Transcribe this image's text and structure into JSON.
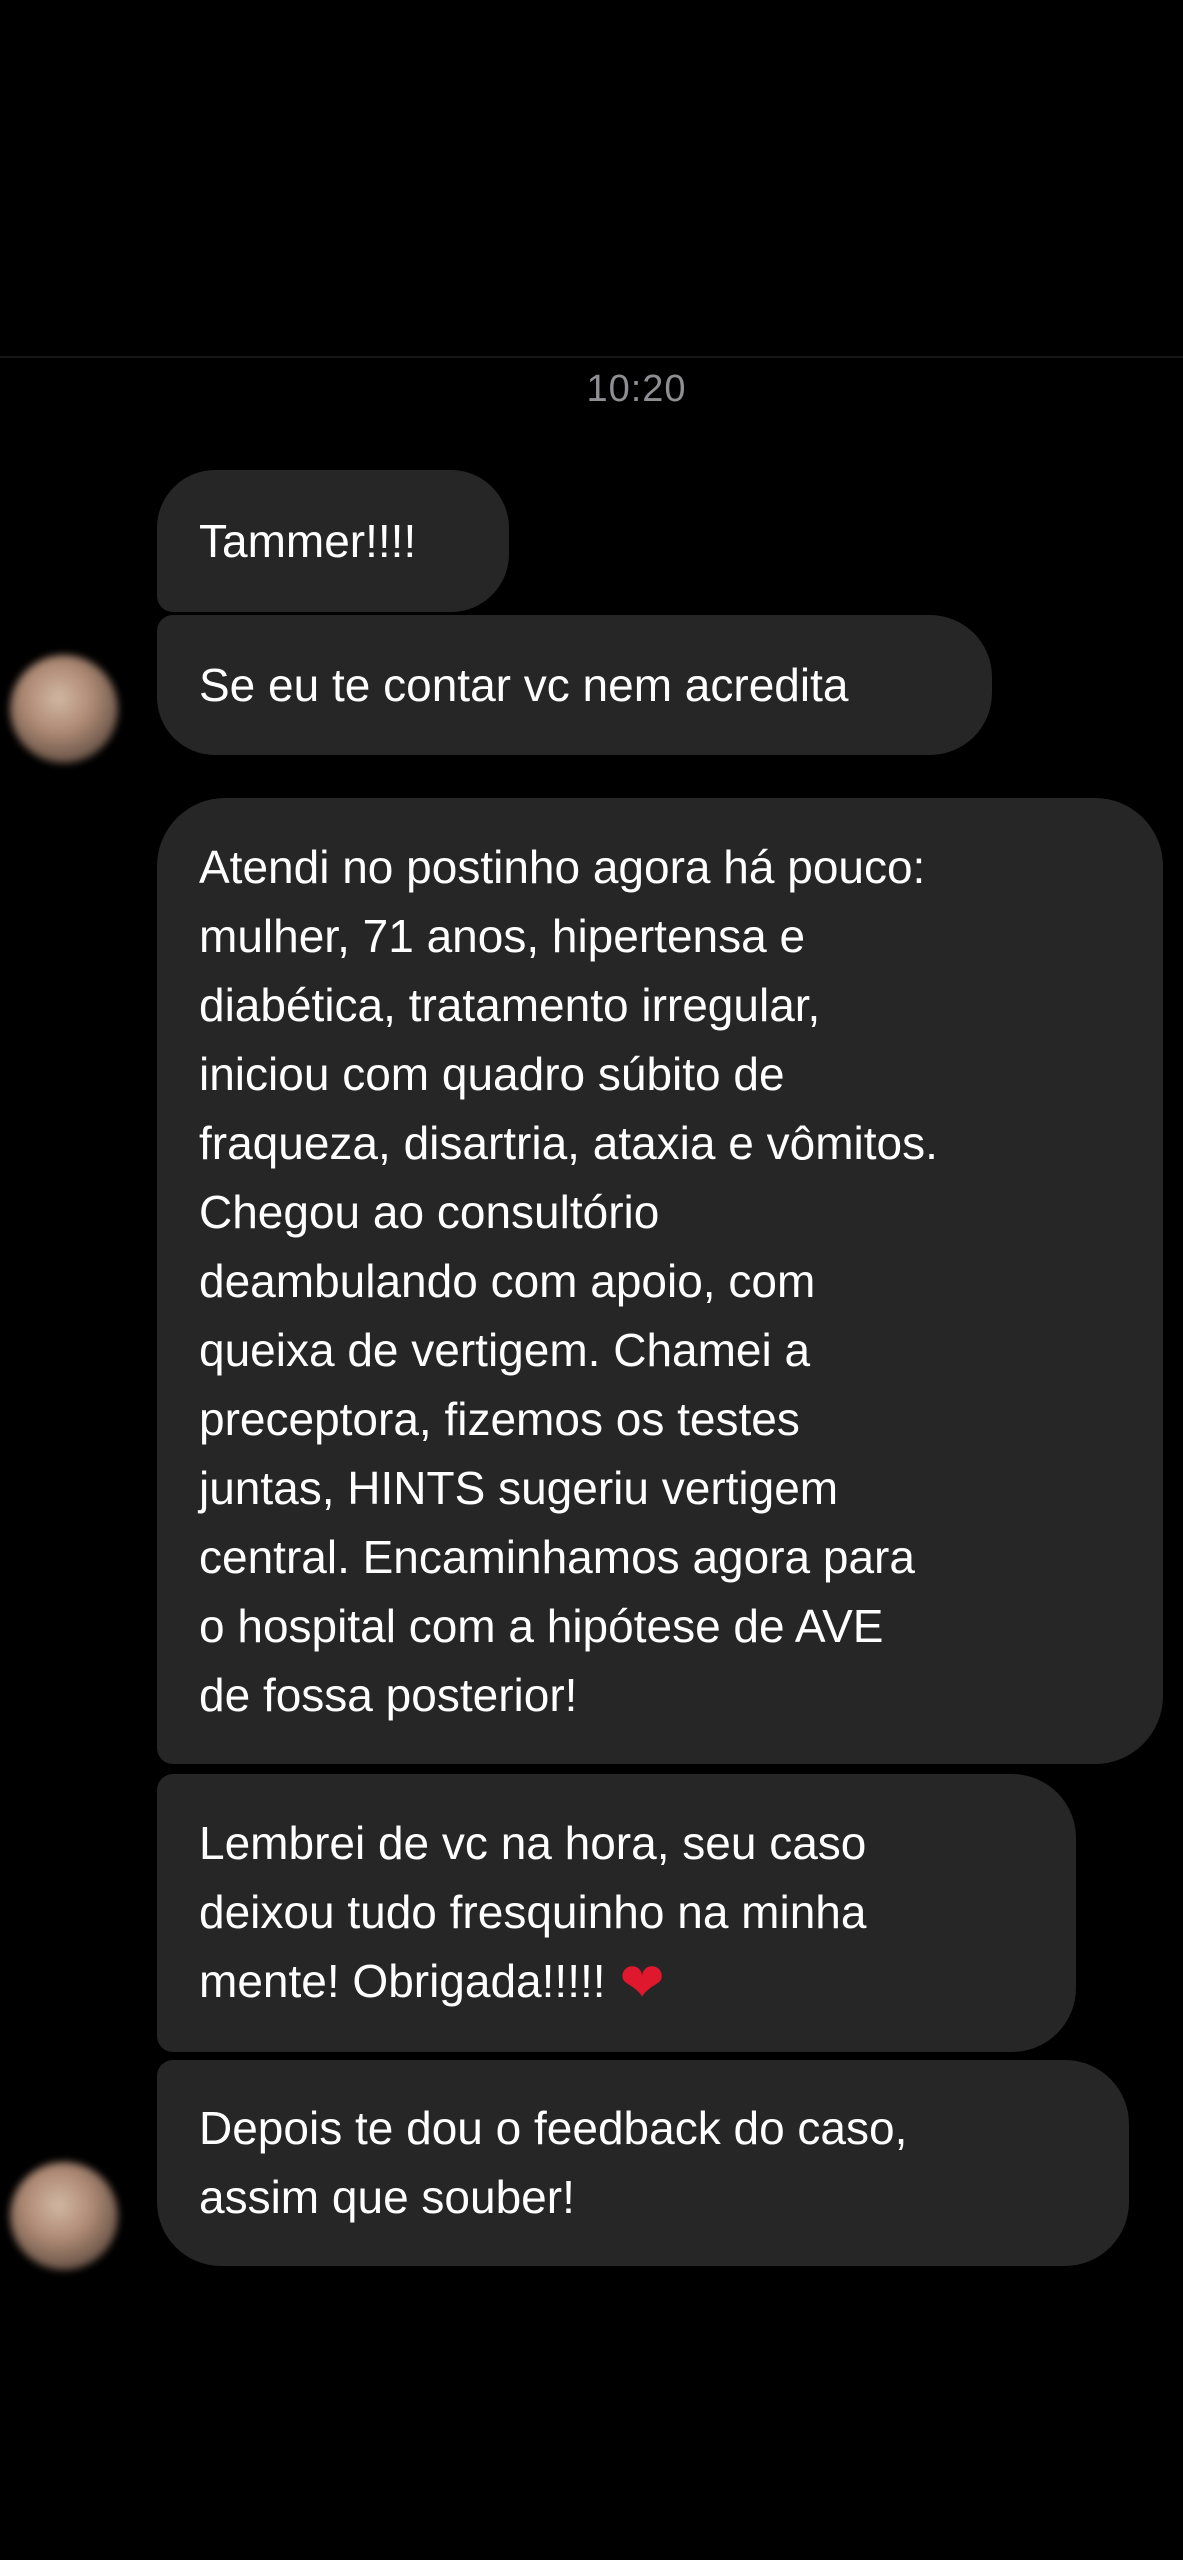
{
  "conversation": {
    "timestamp": "10:20",
    "messages": [
      {
        "lines": [
          "Tammer!!!!"
        ]
      },
      {
        "lines": [
          "Se eu te contar vc nem acredita"
        ]
      },
      {
        "lines": [
          "Atendi no postinho agora há pouco:",
          "mulher, 71 anos, hipertensa e",
          "diabética, tratamento irregular,",
          "iniciou com quadro súbito de",
          "fraqueza, disartria, ataxia e vômitos.",
          "Chegou ao consultório",
          "deambulando com apoio, com",
          "queixa de vertigem. Chamei a",
          "preceptora, fizemos os testes",
          "juntas, HINTS sugeriu vertigem",
          "central. Encaminhamos agora para",
          "o hospital com a hipótese de AVE",
          "de fossa posterior!"
        ]
      },
      {
        "lines": [
          "Lembrei de vc na hora, seu caso",
          "deixou tudo fresquinho na minha",
          "mente! Obrigada!!!!!"
        ],
        "emoji": "❤"
      },
      {
        "lines": [
          "Depois te dou o feedback do caso,",
          "assim que souber!"
        ]
      }
    ]
  },
  "icons": {
    "heart": "red-heart-emoji",
    "avatar": "sender-avatar"
  },
  "colors": {
    "background": "#000000",
    "bubble": "#262626",
    "text": "#ffffff",
    "timestamp": "#8e8e93",
    "heart": "#e0182d"
  }
}
